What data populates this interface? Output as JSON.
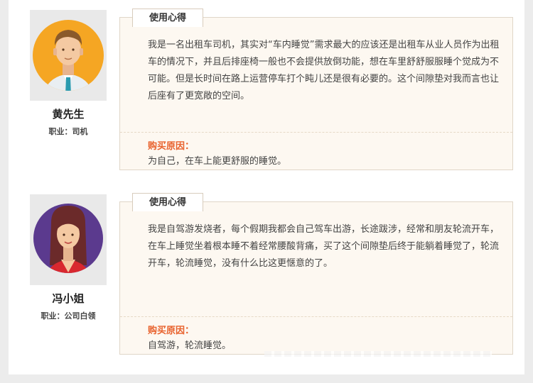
{
  "reviews": [
    {
      "name": "黄先生",
      "job_label": "职业：",
      "job": "司机",
      "tab": "使用心得",
      "text": "我是一名出租车司机，其实对“车内睡觉”需求最大的应该还是出租车从业人员作为出租车的情况下，并且后排座椅一般也不会提供放倒功能，想在车里舒舒服服睡个觉成为不可能。但是长时间在路上运营停车打个盹儿还是很有必要的。这个间隙垫对我而言也让后座有了更宽敞的空间。",
      "reason_title": "购买原因：",
      "reason": "为自己，在车上能更舒服的睡觉。",
      "avatar": {
        "icon": "male-avatar-icon",
        "bg": "#f5a623",
        "shirt": "#e9eef2",
        "tie": "#2a9bb0"
      }
    },
    {
      "name": "冯小姐",
      "job_label": "职业：",
      "job": "公司白领",
      "tab": "使用心得",
      "text": "我是自驾游发烧者，每个假期我都会自己驾车出游，长途跋涉，经常和朋友轮流开车，在车上睡觉坐着根本睡不着经常腰酸背痛，买了这个间隙垫后终于能躺着睡觉了，轮流开车，轮流睡觉，没有什么比这更惬意的了。",
      "reason_title": "购买原因：",
      "reason": "自驾游，轮流睡觉。",
      "avatar": {
        "icon": "female-avatar-icon",
        "bg": "#5b3a8e",
        "dress": "#d8282f",
        "hair": "#6b2a2a"
      }
    }
  ]
}
